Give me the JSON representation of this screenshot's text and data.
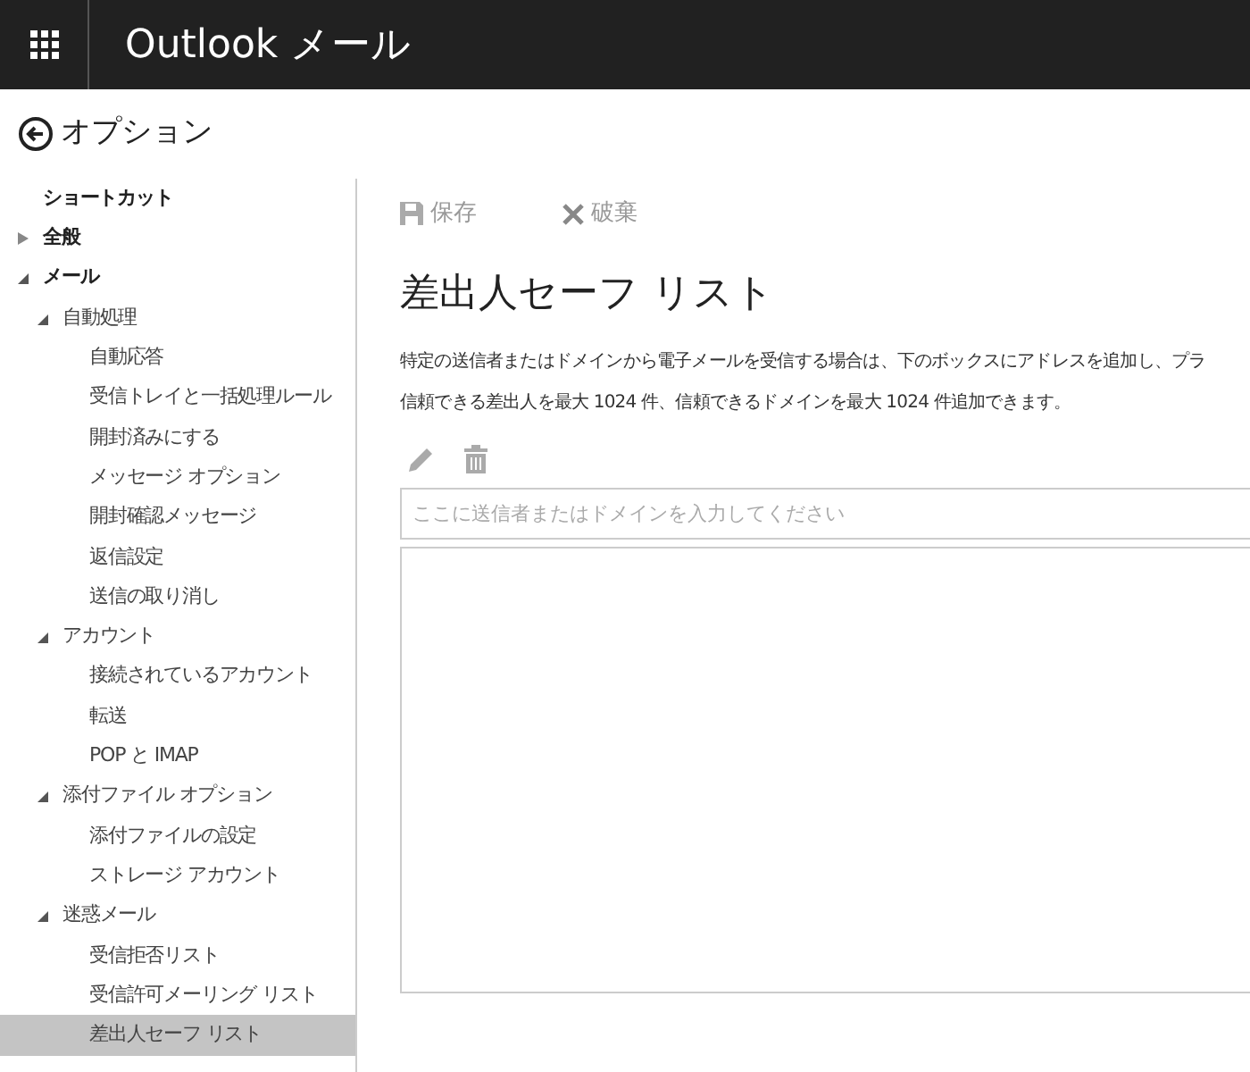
{
  "header": {
    "title": "Outlook メール"
  },
  "options_back": {
    "label": "オプション"
  },
  "sidebar": {
    "items": [
      {
        "label": "ショートカット",
        "selected": false
      },
      {
        "label": "全般",
        "selected": false,
        "expanded": false
      },
      {
        "label": "メール",
        "selected": false,
        "expanded": true,
        "children": [
          {
            "label": "自動処理",
            "selected": false,
            "expanded": true,
            "children": [
              {
                "label": "自動応答",
                "selected": false
              },
              {
                "label": "受信トレイと一括処理ルール",
                "selected": false
              },
              {
                "label": "開封済みにする",
                "selected": false
              },
              {
                "label": "メッセージ オプション",
                "selected": false
              },
              {
                "label": "開封確認メッセージ",
                "selected": false
              },
              {
                "label": "返信設定",
                "selected": false
              },
              {
                "label": "送信の取り消し",
                "selected": false
              }
            ]
          },
          {
            "label": "アカウント",
            "selected": false,
            "expanded": true,
            "children": [
              {
                "label": "接続されているアカウント",
                "selected": false
              },
              {
                "label": "転送",
                "selected": false
              },
              {
                "label": "POP と IMAP",
                "selected": false
              }
            ]
          },
          {
            "label": "添付ファイル オプション",
            "selected": false,
            "expanded": true,
            "children": [
              {
                "label": "添付ファイルの設定",
                "selected": false
              },
              {
                "label": "ストレージ アカウント",
                "selected": false
              }
            ]
          },
          {
            "label": "迷惑メール",
            "selected": false,
            "expanded": true,
            "children": [
              {
                "label": "受信拒否リスト",
                "selected": false
              },
              {
                "label": "受信許可メーリング リスト",
                "selected": false
              },
              {
                "label": "差出人セーフ リスト",
                "selected": true
              }
            ]
          }
        ]
      }
    ]
  },
  "toolbar": {
    "save": "保存",
    "discard": "破棄"
  },
  "page": {
    "title": "差出人セーフ リスト",
    "description": [
      "特定の送信者またはドメインから電子メールを受信する場合は、下のボックスにアドレスを追加し、プラ",
      "信頼できる差出人を最大 1024 件、信頼できるドメインを最大 1024 件追加できます。"
    ],
    "input": {
      "placeholder": "ここに送信者またはドメインを入力してください"
    }
  }
}
